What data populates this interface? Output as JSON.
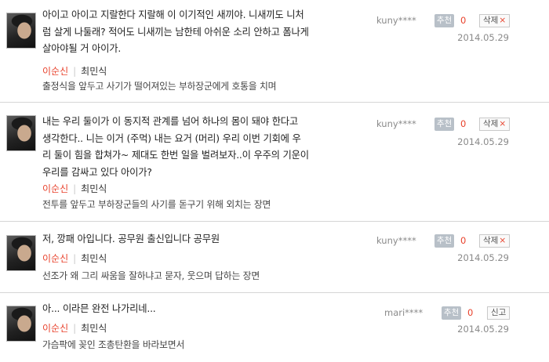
{
  "comments": [
    {
      "quote": "아이고 아이고 지랄한다 지랄해 이 이기적인 새끼야. 니새끼도 니처럼 살게 나둘래? 적어도 니새끼는 남한테 아쉬운 소리 안하고 폼나게 살아야될 거 아이가.",
      "character": "이순신",
      "actor": "최민식",
      "desc": "출정식을 앞두고 사기가 떨어져있는 부하장군에게 호통을 치며",
      "user": "kuny****",
      "rec_label": "추천",
      "rec_count": "0",
      "action_label": "삭제",
      "action_icon": "×",
      "date": "2014.05.29"
    },
    {
      "quote": "내는 우리 둘이가 이 동지적 관계를 넘어 하나의 몸이 돼야 한다고 생각한다.. 니는 이거 (주먹) 내는 요거 (머리) 우리 이번 기회에 우리 둘이 힘을 합쳐가~ 제대도 한번 일을 벌려보자..이 우주의 기운이 우리를 감싸고 있다 아이가?",
      "character": "이순신",
      "actor": "최민식",
      "desc": "전투를 앞두고 부하장군들의 사기를 돋구기 위해 외치는 장면",
      "user": "kuny****",
      "rec_label": "추천",
      "rec_count": "0",
      "action_label": "삭제",
      "action_icon": "×",
      "date": "2014.05.29"
    },
    {
      "quote": "저, 깡패 아입니다. 공무원 출신입니다 공무원",
      "character": "이순신",
      "actor": "최민식",
      "desc": "선조가 왜 그리 싸움을 잘하냐고 묻자, 웃으며 답하는 장면",
      "user": "kuny****",
      "rec_label": "추천",
      "rec_count": "0",
      "action_label": "삭제",
      "action_icon": "×",
      "date": "2014.05.29"
    },
    {
      "quote": "아... 이라믄 완전 나가리네...",
      "character": "이순신",
      "actor": "최민식",
      "desc": "가슴팍에 꽂인 조총탄환을 바라보면서",
      "user": "mari****",
      "rec_label": "추천",
      "rec_count": "0",
      "action_label": "신고",
      "action_icon": "",
      "date": "2014.05.29"
    }
  ]
}
